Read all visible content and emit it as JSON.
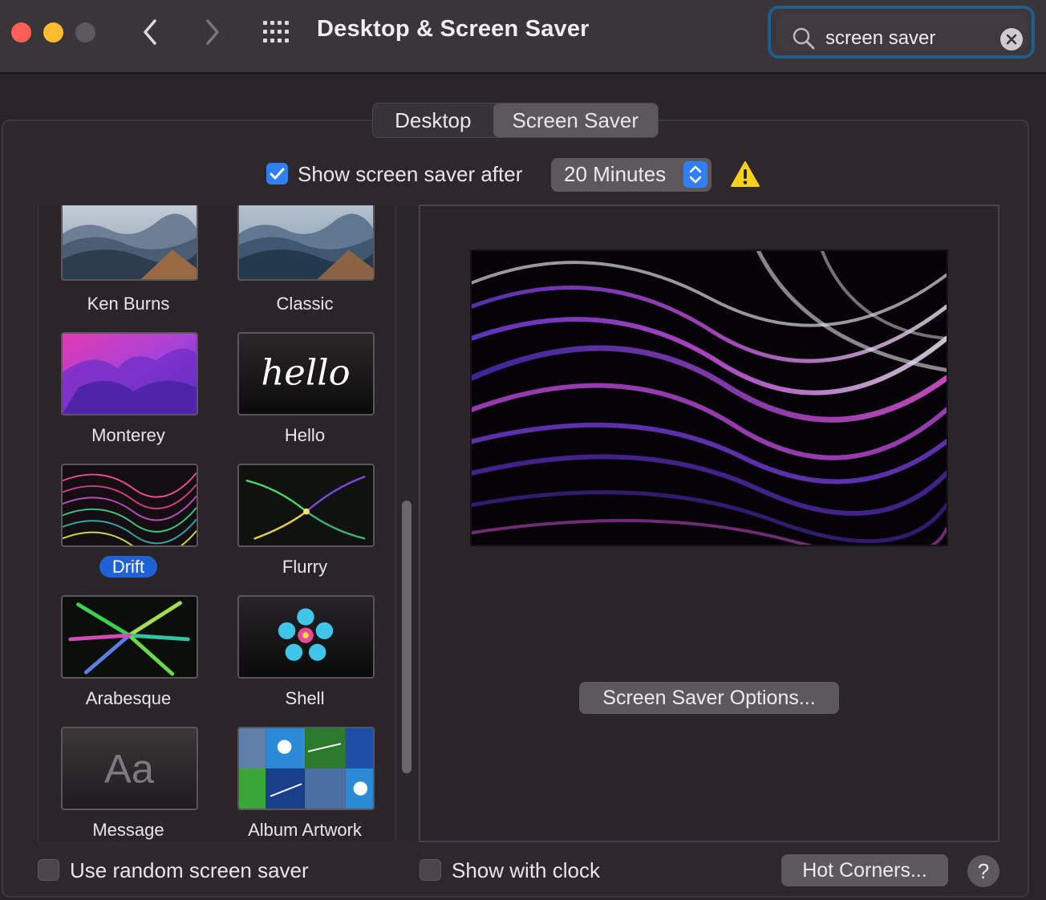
{
  "window": {
    "title": "Desktop & Screen Saver"
  },
  "search": {
    "value": "screen saver"
  },
  "tabs": [
    {
      "label": "Desktop"
    },
    {
      "label": "Screen Saver"
    }
  ],
  "show_after": {
    "label": "Show screen saver after",
    "checked": true,
    "duration": "20 Minutes"
  },
  "screensavers": [
    {
      "name": "Ken Burns"
    },
    {
      "name": "Classic"
    },
    {
      "name": "Monterey"
    },
    {
      "name": "Hello"
    },
    {
      "name": "Drift",
      "selected": true
    },
    {
      "name": "Flurry"
    },
    {
      "name": "Arabesque"
    },
    {
      "name": "Shell"
    },
    {
      "name": "Message"
    },
    {
      "name": "Album Artwork"
    }
  ],
  "hello_thumb_text": "hello",
  "message_thumb_text": "Aa",
  "preview": {
    "options_button": "Screen Saver Options..."
  },
  "footer": {
    "random_label": "Use random screen saver",
    "clock_label": "Show with clock",
    "hot_corners": "Hot Corners...",
    "help": "?"
  },
  "colors": {
    "accent": "#2f7ff5",
    "selection": "#1f62d6",
    "search_focus": "#1f5d8a"
  }
}
